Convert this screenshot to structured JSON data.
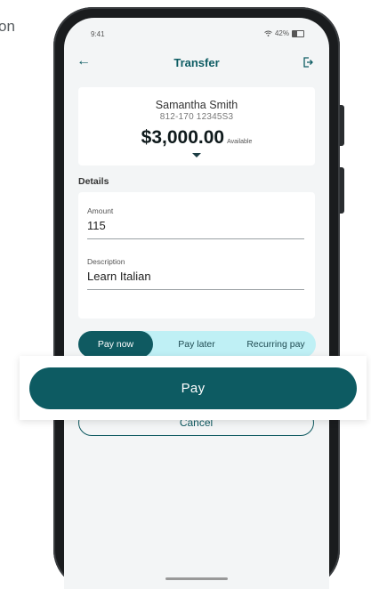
{
  "background_text": "on",
  "status_bar": {
    "time": "9:41",
    "battery": "42%"
  },
  "nav": {
    "title": "Transfer",
    "back_icon": "arrow-left-icon",
    "exit_icon": "logout-icon"
  },
  "account": {
    "name": "Samantha Smith",
    "number": "812-170  12345S3",
    "balance": "$3,000.00",
    "available_label": "Available"
  },
  "details": {
    "heading": "Details",
    "amount": {
      "label": "Amount",
      "value": "115"
    },
    "description": {
      "label": "Description",
      "value": "Learn Italian"
    }
  },
  "payment_options": {
    "selected": "Pay now",
    "options": [
      "Pay now",
      "Pay later",
      "Recurring pay"
    ]
  },
  "buttons": {
    "pay": "Pay",
    "cancel": "Cancel"
  },
  "colors": {
    "brand": "#0d5b62",
    "segment_bg": "#bff0f5",
    "screen_bg": "#f3f5f6"
  }
}
